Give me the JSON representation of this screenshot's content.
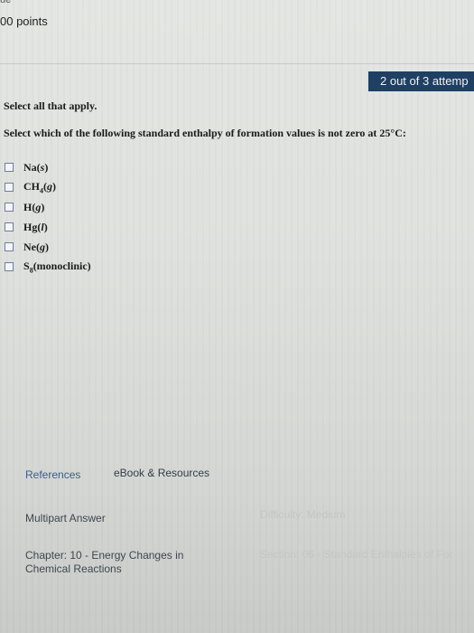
{
  "header": {
    "cut_text": "ue",
    "points": "00 points"
  },
  "attempts_badge": "2 out of 3 attemp",
  "question": {
    "instruction": "Select all that apply.",
    "prompt": "Select which of the following standard enthalpy of formation values is not zero at 25°C:"
  },
  "options": [
    {
      "formula": "Na",
      "state": "s"
    },
    {
      "formula_main": "CH",
      "formula_sub": "4",
      "state": "g"
    },
    {
      "formula": "H",
      "state": "g"
    },
    {
      "formula": "Hg",
      "state": "l"
    },
    {
      "formula": "Ne",
      "state": "g"
    },
    {
      "formula_main": "S",
      "formula_sub": "8",
      "state_text": "(monoclinic)"
    }
  ],
  "footer": {
    "references": "References",
    "ebook": "eBook & Resources",
    "multipart": "Multipart Answer",
    "difficulty": "Difficulty: Medium",
    "chapter": "Chapter: 10 - Energy Changes in Chemical Reactions",
    "section": "Section: 06 - Standard Enthalpies of For"
  }
}
